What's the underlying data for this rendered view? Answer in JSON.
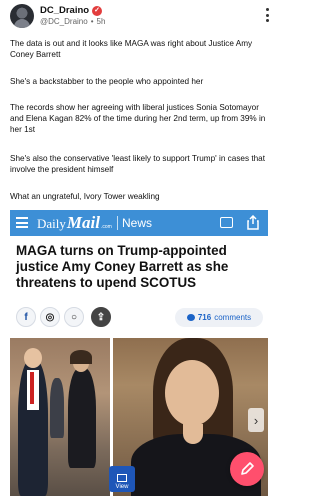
{
  "post": {
    "author": {
      "display_name": "DC_Draino",
      "handle": "@DC_Draino",
      "separator": "•",
      "time_ago": "5h"
    },
    "paragraphs": [
      "The data is out and it looks like MAGA was right about Justice Amy Coney Barrett",
      "She's a backstabber to the people who appointed her",
      "The records show her agreeing with liberal justices Sonia Sotomayor and Elena Kagan 82% of the time during her 2nd term, up from 39% in her 1st",
      "She's also the conservative 'least likely to support Trump' in cases that involve the president himself",
      "What an ungrateful, Ivory Tower weakling"
    ]
  },
  "article": {
    "brand_daily": "Daily",
    "brand_mail": "Mail",
    "brand_com": ".com",
    "section": "News",
    "headline": "MAGA turns on Trump-appointed justice Amy Coney Barrett as she threatens to upend SCOTUS",
    "comments_count": "716",
    "comments_label": "comments",
    "view_label": "View",
    "brand_color": "#3d8fd6"
  },
  "icons": {
    "verified": "check-badge-icon",
    "more": "more-vertical-icon",
    "menu": "hamburger-menu-icon",
    "chat": "chat-icon",
    "share": "share-icon",
    "facebook": "facebook-icon",
    "whatsapp": "whatsapp-icon",
    "next": "chevron-right-icon",
    "compose": "compose-icon"
  },
  "colors": {
    "compose_fab": "#ff4f6d",
    "comments_text": "#1b63c7"
  }
}
